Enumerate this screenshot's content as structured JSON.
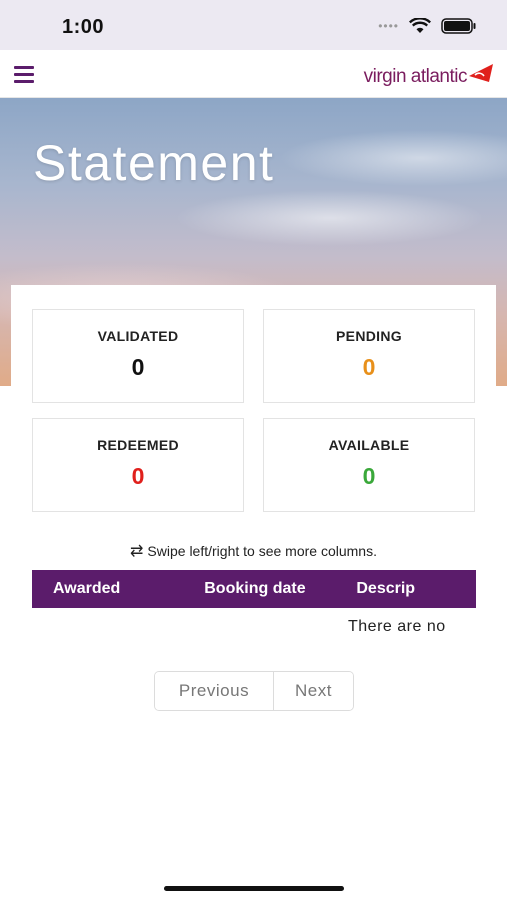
{
  "status_bar": {
    "time": "1:00"
  },
  "header": {
    "brand": "virgin atlantic"
  },
  "hero": {
    "title": "Statement"
  },
  "stats": [
    {
      "label": "VALIDATED",
      "value": "0",
      "color": "#111111"
    },
    {
      "label": "PENDING",
      "value": "0",
      "color": "#e8901a"
    },
    {
      "label": "REDEEMED",
      "value": "0",
      "color": "#e0201c"
    },
    {
      "label": "AVAILABLE",
      "value": "0",
      "color": "#3aa83a"
    }
  ],
  "swipe_hint": "Swipe left/right to see more columns.",
  "table": {
    "headers": [
      "Awarded",
      "Booking date",
      "Descrip"
    ],
    "empty_message": "There are no"
  },
  "pagination": {
    "previous": "Previous",
    "next": "Next"
  },
  "colors": {
    "brand_purple": "#5b1c6b",
    "brand_red": "#e0201c"
  }
}
